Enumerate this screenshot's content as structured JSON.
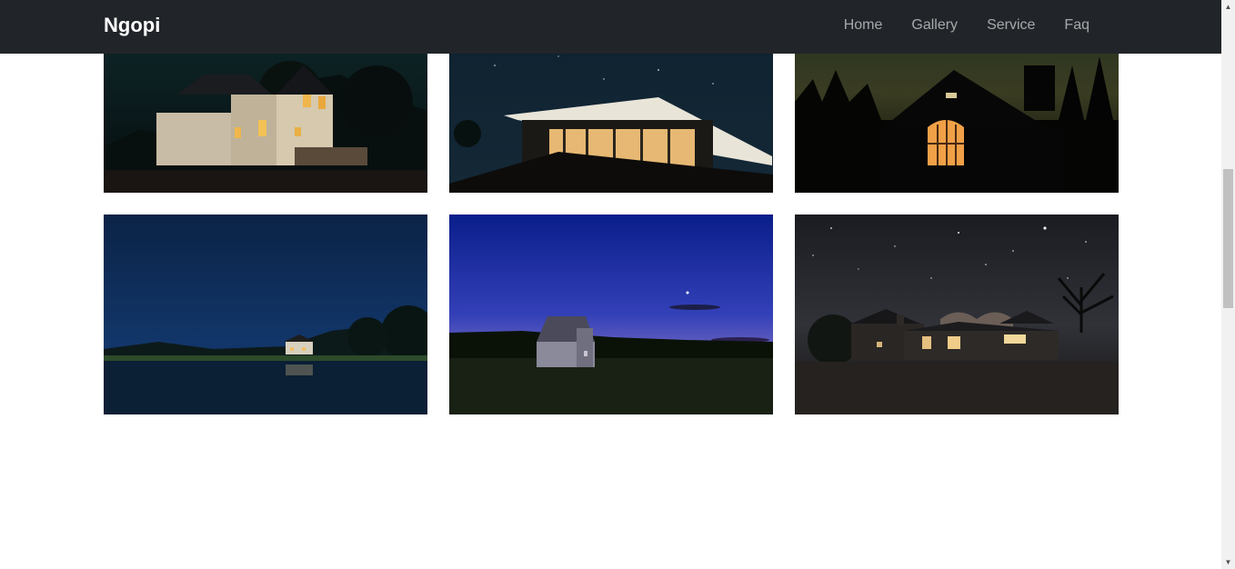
{
  "navbar": {
    "brand": "Ngopi",
    "links": [
      "Home",
      "Gallery",
      "Service",
      "Faq"
    ]
  },
  "gallery": {
    "images": [
      {
        "alt": "house-night-1"
      },
      {
        "alt": "house-night-2"
      },
      {
        "alt": "house-night-3"
      },
      {
        "alt": "house-night-4"
      },
      {
        "alt": "house-night-5"
      },
      {
        "alt": "house-night-6"
      }
    ]
  },
  "colors": {
    "navbar_bg": "#212529",
    "nav_link": "rgba(255,255,255,0.6)",
    "brand": "#ffffff"
  }
}
